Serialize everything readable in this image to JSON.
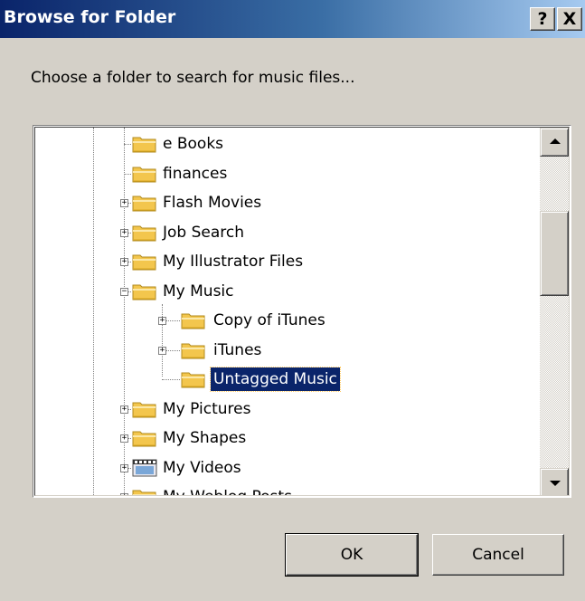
{
  "window": {
    "title": "Browse for Folder",
    "help_label": "?",
    "close_label": "X"
  },
  "instruction": "Choose a folder to search for music files...",
  "tree": {
    "items": [
      {
        "label": "e Books",
        "expander": null,
        "depth": 1,
        "icon": "folder-icon"
      },
      {
        "label": "finances",
        "expander": null,
        "depth": 1,
        "icon": "folder-icon"
      },
      {
        "label": "Flash Movies",
        "expander": "+",
        "depth": 1,
        "icon": "folder-icon"
      },
      {
        "label": "Job Search",
        "expander": "+",
        "depth": 1,
        "icon": "folder-icon"
      },
      {
        "label": "My Illustrator Files",
        "expander": "+",
        "depth": 1,
        "icon": "folder-icon"
      },
      {
        "label": "My Music",
        "expander": "−",
        "depth": 1,
        "icon": "folder-open-icon"
      },
      {
        "label": "Copy of iTunes",
        "expander": "+",
        "depth": 2,
        "icon": "folder-icon"
      },
      {
        "label": "iTunes",
        "expander": "+",
        "depth": 2,
        "icon": "folder-icon"
      },
      {
        "label": "Untagged Music",
        "expander": null,
        "depth": 2,
        "icon": "folder-icon",
        "selected": true
      },
      {
        "label": "My Pictures",
        "expander": "+",
        "depth": 1,
        "icon": "folder-icon"
      },
      {
        "label": "My Shapes",
        "expander": "+",
        "depth": 1,
        "icon": "folder-icon"
      },
      {
        "label": "My Videos",
        "expander": "+",
        "depth": 1,
        "icon": "video-folder-icon"
      },
      {
        "label": "My Weblog Posts",
        "expander": "+",
        "depth": 1,
        "icon": "folder-icon"
      }
    ]
  },
  "buttons": {
    "ok": "OK",
    "cancel": "Cancel"
  },
  "colors": {
    "selection": "#0a246a",
    "dialog_face": "#d4d0c8",
    "folder": "#f3c64d"
  }
}
